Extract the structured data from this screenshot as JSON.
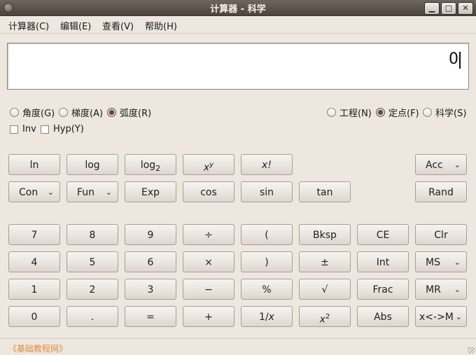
{
  "window": {
    "title": "计算器 - 科学",
    "minimize": "▁",
    "maximize": "□",
    "close": "✕"
  },
  "menu": [
    "计算器(C)",
    "编辑(E)",
    "查看(V)",
    "帮助(H)"
  ],
  "display": {
    "value": "0"
  },
  "angle_units": [
    {
      "label": "角度(G)",
      "selected": false
    },
    {
      "label": "梯度(A)",
      "selected": false
    },
    {
      "label": "弧度(R)",
      "selected": true
    }
  ],
  "notation": [
    {
      "label": "工程(N)",
      "selected": false
    },
    {
      "label": "定点(F)",
      "selected": true
    },
    {
      "label": "科学(S)",
      "selected": false
    }
  ],
  "modifiers": [
    {
      "label": "Inv",
      "checked": false
    },
    {
      "label": "Hyp(Y)",
      "checked": false
    }
  ],
  "buttons": {
    "ln": "ln",
    "log": "log",
    "log2_base": "log",
    "log2_sub": "2",
    "xy_base": "x",
    "xy_sup": "y",
    "fact": "x!",
    "acc": "Acc",
    "con": "Con",
    "fun": "Fun",
    "exp": "Exp",
    "cos": "cos",
    "sin": "sin",
    "tan": "tan",
    "rand": "Rand",
    "d7": "7",
    "d8": "8",
    "d9": "9",
    "div": "÷",
    "lparen": "(",
    "bksp": "Bksp",
    "ce": "CE",
    "clr": "Clr",
    "d4": "4",
    "d5": "5",
    "d6": "6",
    "mul": "×",
    "rparen": ")",
    "pm": "±",
    "int": "Int",
    "ms": "MS",
    "d1": "1",
    "d2": "2",
    "d3": "3",
    "minus": "−",
    "pct": "%",
    "sqrt": "√",
    "frac": "Frac",
    "mr": "MR",
    "d0": "0",
    "dot": ".",
    "eq": "=",
    "plus": "+",
    "recip_a": "1/",
    "recip_b": "x",
    "sq_base": "x",
    "sq_sup": "2",
    "abs": "Abs",
    "xm": "x<->M"
  },
  "dropdown_arrow": "⌄",
  "footer": "《基础教程网》"
}
